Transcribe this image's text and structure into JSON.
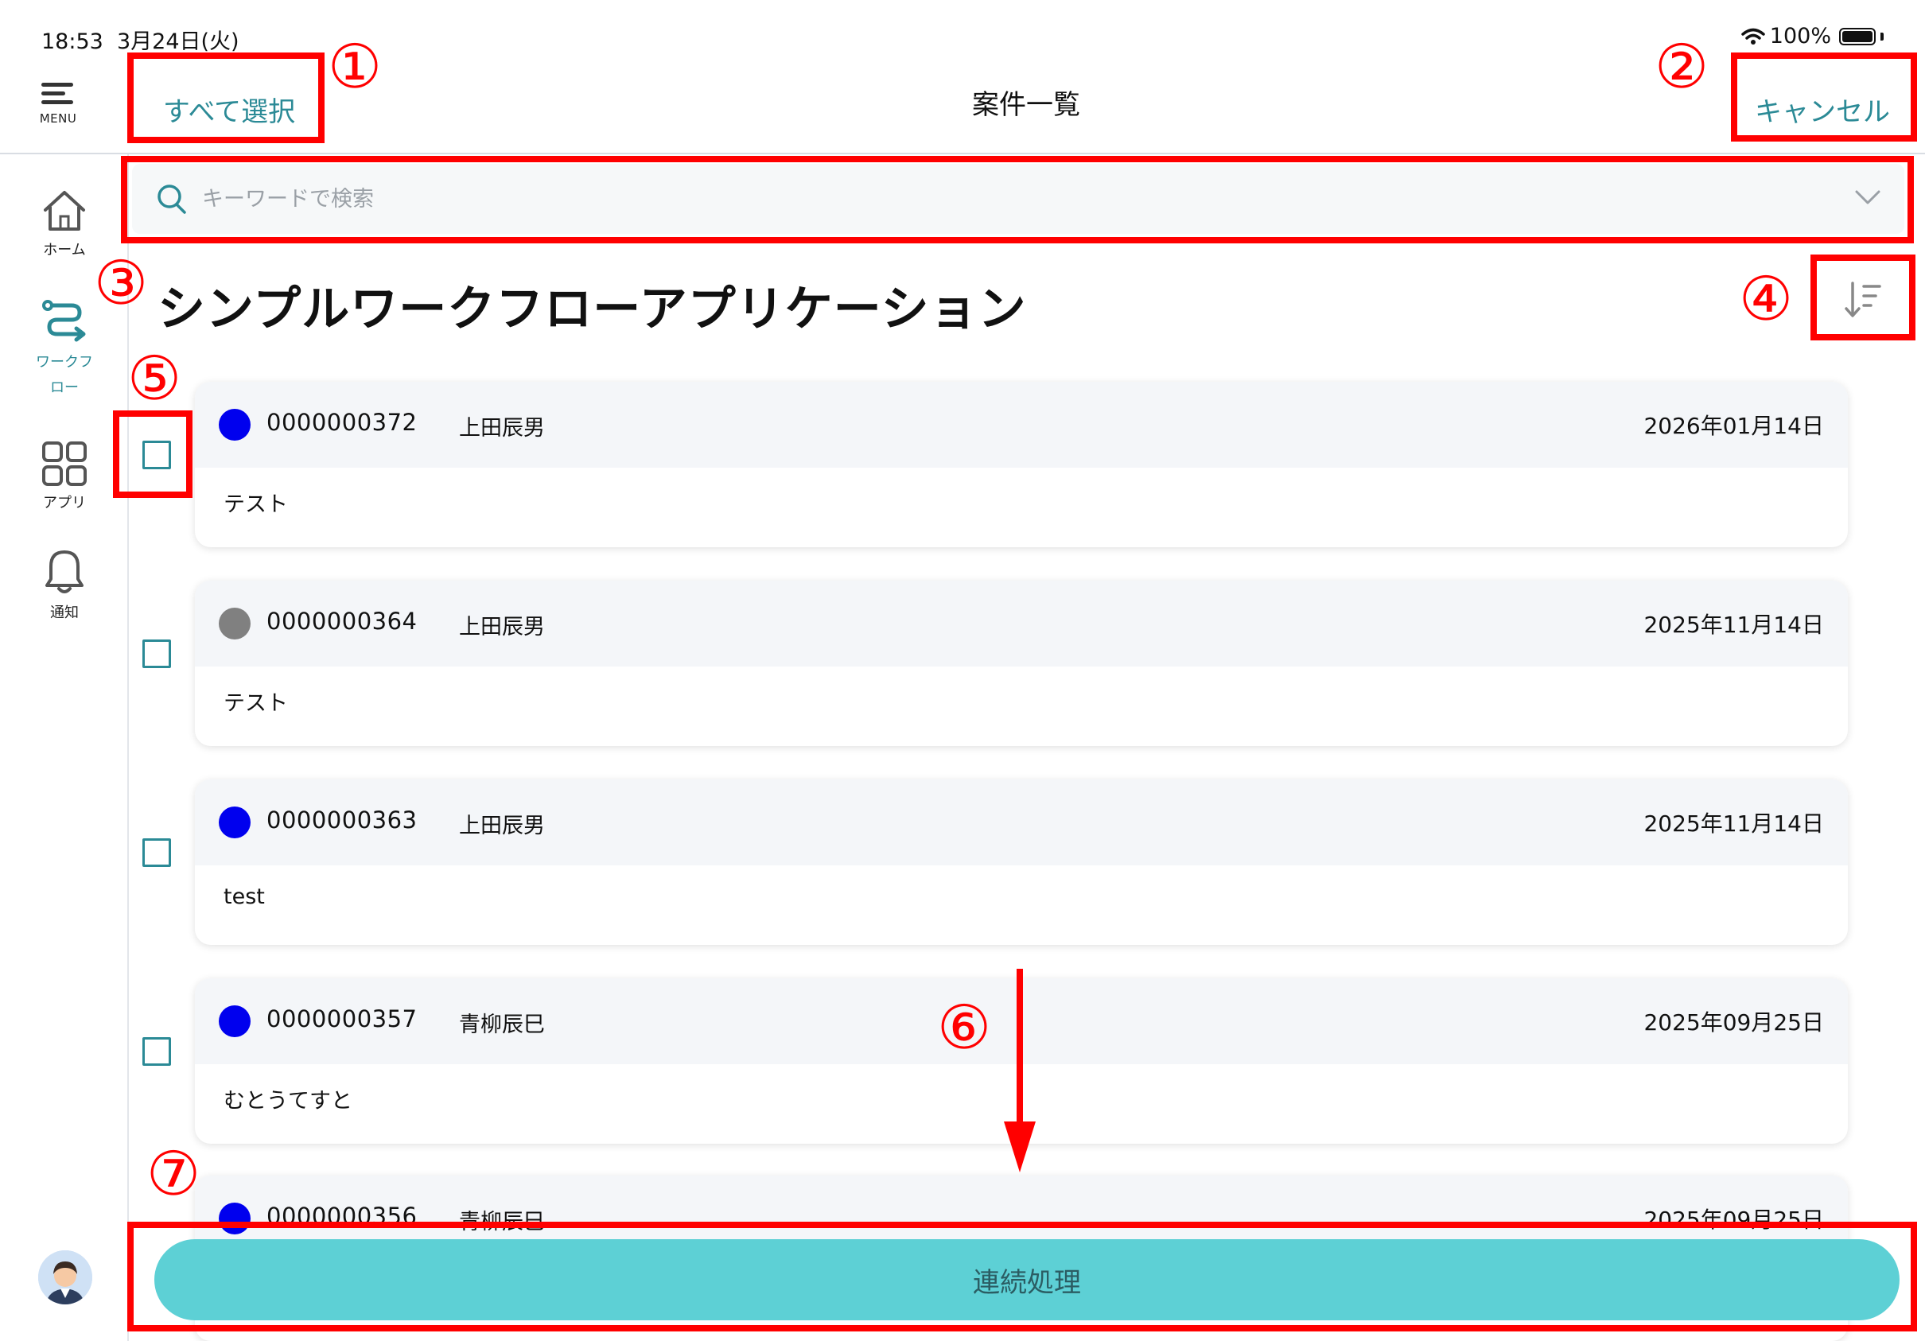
{
  "status_bar": {
    "time": "18:53",
    "date": "3月24日(火)",
    "battery": "100%"
  },
  "header": {
    "menu_label": "MENU",
    "select_all": "すべて選択",
    "title": "案件一覧",
    "cancel": "キャンセル"
  },
  "sidebar": {
    "items": [
      {
        "label": "ホーム",
        "icon": "home-icon"
      },
      {
        "label": "ワークフ\nロー",
        "icon": "workflow-icon"
      },
      {
        "label": "アプリ",
        "icon": "grid-icon"
      },
      {
        "label": "通知",
        "icon": "bell-icon"
      }
    ],
    "active_color": "#2b8a96"
  },
  "search": {
    "placeholder": "キーワードで検索"
  },
  "app_title": "シンプルワークフローアプリケーション",
  "cases": [
    {
      "number": "0000000372",
      "person": "上田辰男",
      "date": "2026年01月14日",
      "subject": "テスト",
      "status_color": "#0000ee"
    },
    {
      "number": "0000000364",
      "person": "上田辰男",
      "date": "2025年11月14日",
      "subject": "テスト",
      "status_color": "#808080"
    },
    {
      "number": "0000000363",
      "person": "上田辰男",
      "date": "2025年11月14日",
      "subject": "test",
      "status_color": "#0000ee"
    },
    {
      "number": "0000000357",
      "person": "青柳辰巳",
      "date": "2025年09月25日",
      "subject": "むとうてすと",
      "status_color": "#0000ee"
    },
    {
      "number": "0000000356",
      "person": "青柳辰巳",
      "date": "2025年09月25日",
      "subject": "",
      "status_color": "#0000ee"
    }
  ],
  "footer": {
    "process_button": "連続処理"
  },
  "annotations": [
    "①",
    "②",
    "③",
    "④",
    "⑤",
    "⑥",
    "⑦"
  ],
  "colors": {
    "accent": "#2b8a96",
    "button": "#5dd0d5",
    "annotation": "#ff0000"
  }
}
